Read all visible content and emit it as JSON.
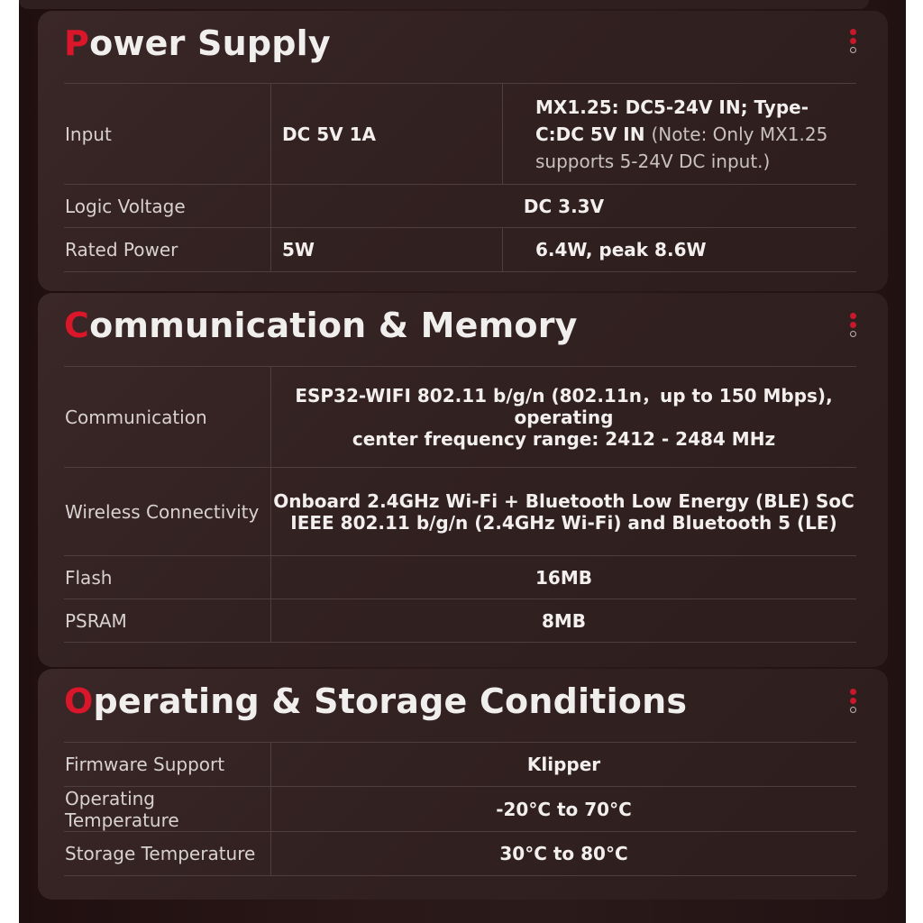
{
  "sections": [
    {
      "title_first": "P",
      "title_rest": "ower Supply",
      "rows": [
        {
          "label": "Input",
          "col1": "DC 5V 1A",
          "col2_bold": "MX1.25: DC5-24V IN; Type-C:DC 5V IN",
          "col2_note": "(Note: Only MX1.25 supports 5-24V DC input.)"
        },
        {
          "label": "Logic Voltage",
          "value": "DC 3.3V"
        },
        {
          "label": "Rated Power",
          "col1": "5W",
          "col2": "6.4W, peak 8.6W"
        }
      ]
    },
    {
      "title_first": "C",
      "title_rest": "ommunication & Memory",
      "rows": [
        {
          "label": "Communication",
          "line1": "ESP32-WIFI 802.11 b/g/n (802.11n，up to 150 Mbps), operating",
          "line2": "center frequency range: 2412 - 2484 MHz"
        },
        {
          "label": "Wireless Connectivity",
          "line1": "Onboard 2.4GHz Wi-Fi + Bluetooth Low Energy (BLE) SoC",
          "line2": "IEEE 802.11 b/g/n (2.4GHz Wi-Fi) and Bluetooth 5 (LE)"
        },
        {
          "label": "Flash",
          "value": "16MB"
        },
        {
          "label": "PSRAM",
          "value": "8MB"
        }
      ]
    },
    {
      "title_first": "O",
      "title_rest": "perating & Storage Conditions",
      "rows": [
        {
          "label": "Firmware Support",
          "value": "Klipper"
        },
        {
          "label": "Operating Temperature",
          "value": "-20°C to 70°C"
        },
        {
          "label": "Storage Temperature",
          "value": "30°C to 80°C"
        }
      ]
    }
  ],
  "colors": {
    "accent": "#d9162a",
    "background": "#2a1818",
    "card": "#352323",
    "text": "#f1eeee"
  },
  "icons": {
    "menu": "vertical-dots-icon"
  }
}
